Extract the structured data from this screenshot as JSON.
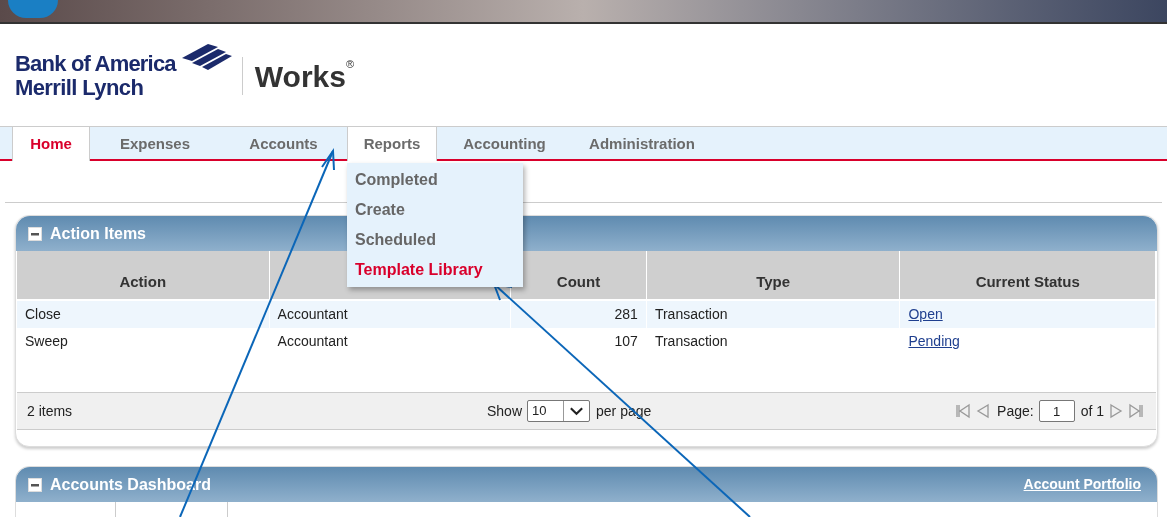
{
  "logo": {
    "bank_line1": "Bank of America",
    "bank_line2": "Merrill Lynch",
    "product": "Works",
    "registered": "®"
  },
  "nav": {
    "tabs": [
      {
        "label": "Home",
        "selected": true,
        "open": false
      },
      {
        "label": "Expenses",
        "selected": false,
        "open": false
      },
      {
        "label": "Accounts",
        "selected": false,
        "open": false
      },
      {
        "label": "Reports",
        "selected": false,
        "open": true
      },
      {
        "label": "Accounting",
        "selected": false,
        "open": false
      },
      {
        "label": "Administration",
        "selected": false,
        "open": false
      }
    ]
  },
  "reports_menu": {
    "items": [
      {
        "label": "Completed",
        "selected": false
      },
      {
        "label": "Create",
        "selected": false
      },
      {
        "label": "Scheduled",
        "selected": false
      },
      {
        "label": "Template Library",
        "selected": true
      }
    ]
  },
  "action_items": {
    "title": "Action Items",
    "columns": [
      {
        "label": "Action",
        "kind": "text"
      },
      {
        "kind": "text"
      },
      {
        "label": "Count",
        "kind": "number"
      },
      {
        "label": "Type",
        "kind": "text"
      },
      {
        "label": "Current Status",
        "kind": "link"
      }
    ],
    "rows": [
      {
        "cells": [
          "Close",
          "Accountant",
          "281",
          "Transaction",
          "Open"
        ]
      },
      {
        "cells": [
          "Sweep",
          "Accountant",
          "107",
          "Transaction",
          "Pending"
        ]
      }
    ],
    "footer": {
      "item_count": "2 items",
      "show_label": "Show",
      "page_size": "10",
      "per_page_label": "per page",
      "page_label": "Page:",
      "page": "1",
      "of_label": "of 1"
    }
  },
  "accounts_dashboard": {
    "title": "Accounts Dashboard",
    "link": "Account Portfolio"
  }
}
